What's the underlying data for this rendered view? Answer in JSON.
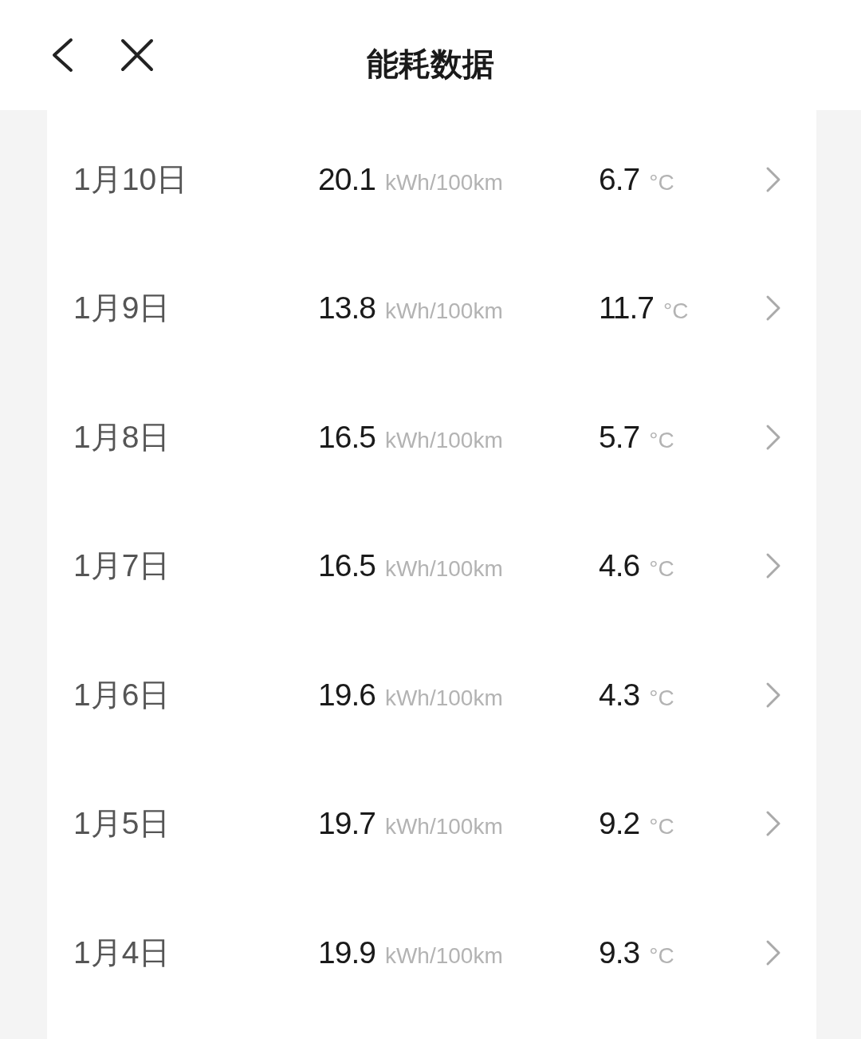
{
  "header": {
    "title": "能耗数据"
  },
  "rows": [
    {
      "date": "1月10日",
      "consumption": "20.1",
      "consumption_unit": "kWh/100km",
      "temperature": "6.7",
      "temperature_unit": "°C"
    },
    {
      "date": "1月9日",
      "consumption": "13.8",
      "consumption_unit": "kWh/100km",
      "temperature": "11.7",
      "temperature_unit": "°C"
    },
    {
      "date": "1月8日",
      "consumption": "16.5",
      "consumption_unit": "kWh/100km",
      "temperature": "5.7",
      "temperature_unit": "°C"
    },
    {
      "date": "1月7日",
      "consumption": "16.5",
      "consumption_unit": "kWh/100km",
      "temperature": "4.6",
      "temperature_unit": "°C"
    },
    {
      "date": "1月6日",
      "consumption": "19.6",
      "consumption_unit": "kWh/100km",
      "temperature": "4.3",
      "temperature_unit": "°C"
    },
    {
      "date": "1月5日",
      "consumption": "19.7",
      "consumption_unit": "kWh/100km",
      "temperature": "9.2",
      "temperature_unit": "°C"
    },
    {
      "date": "1月4日",
      "consumption": "19.9",
      "consumption_unit": "kWh/100km",
      "temperature": "9.3",
      "temperature_unit": "°C"
    }
  ]
}
